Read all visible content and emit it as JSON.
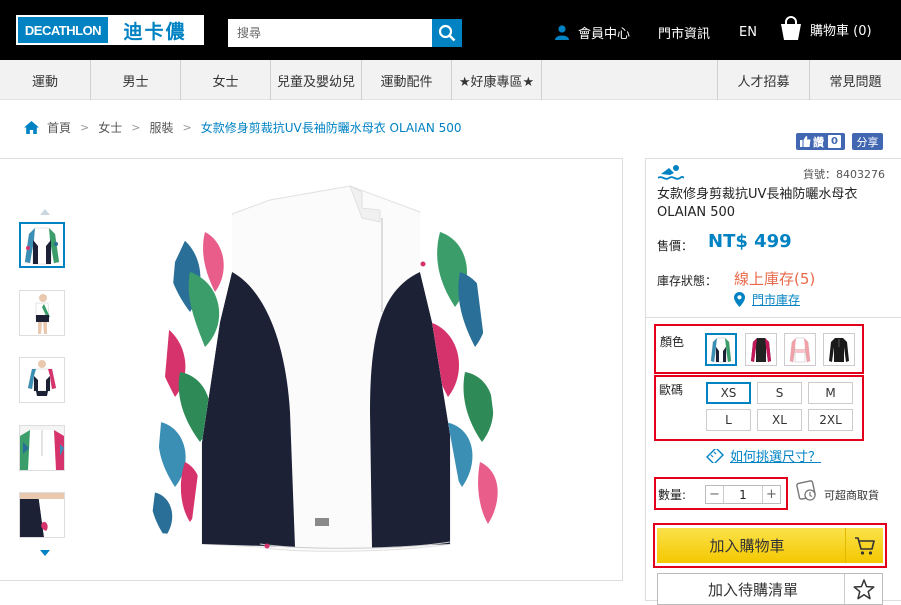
{
  "header": {
    "logo_en": "DECATHLON",
    "logo_zh": "迪卡儂",
    "search_placeholder": "搜尋",
    "member": "會員中心",
    "stores": "門市資訊",
    "lang": "EN",
    "cart": "購物車 (0)"
  },
  "categories": {
    "left": [
      "運動",
      "男士",
      "女士",
      "兒童及嬰幼兒",
      "運動配件",
      "★好康專區★"
    ],
    "right": [
      "人才招募",
      "常見問題"
    ]
  },
  "breadcrumb": {
    "home": "首頁",
    "items": [
      "女士",
      "服裝"
    ],
    "current": "女款修身剪裁抗UV長袖防曬水母衣 OLAIAN 500"
  },
  "social": {
    "like_label": "讚",
    "like_count": "0",
    "share_label": "分享"
  },
  "product": {
    "sku": "貨號：8403276",
    "title": "女款修身剪裁抗UV長袖防曬水母衣 OLAIAN 500",
    "price_label": "售價：",
    "price": "NT$ 499",
    "stock_label": "庫存狀態：",
    "stock": "線上庫存(5)",
    "store_stock": "門市庫存",
    "color_label": "顏色",
    "size_label": "歐碼",
    "sizes": [
      "XS",
      "S",
      "M",
      "L",
      "XL",
      "2XL"
    ],
    "selected_size": "XS",
    "size_guide": "如何挑選尺寸？",
    "qty_label": "數量:",
    "qty": "1",
    "minus": "−",
    "plus": "+",
    "pickup": "可超商取貨",
    "add_cart": "加入購物車",
    "wishlist": "加入待購清單"
  },
  "colors": {
    "brand": "#0082c3",
    "price": "#0082c3",
    "stock": "#e86a4a",
    "highlight_box": "#e3001b",
    "cart_button": "#f4c800"
  }
}
